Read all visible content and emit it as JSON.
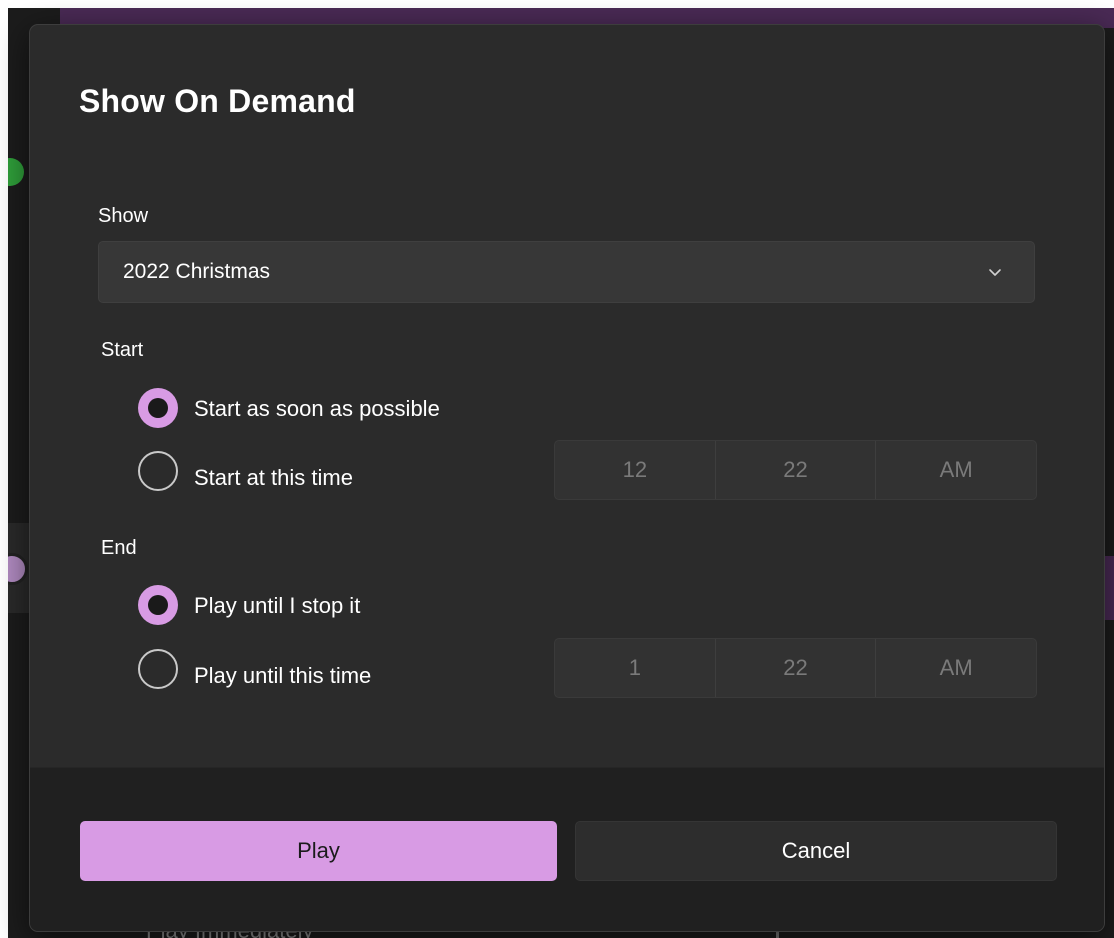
{
  "dialog": {
    "title": "Show On Demand"
  },
  "show": {
    "label": "Show",
    "selected": "2022 Christmas"
  },
  "start": {
    "label": "Start",
    "options": [
      {
        "label": "Start as soon as possible",
        "selected": true
      },
      {
        "label": "Start at this time",
        "selected": false
      }
    ],
    "time": {
      "hour": "12",
      "minute": "22",
      "period": "AM"
    }
  },
  "end": {
    "label": "End",
    "options": [
      {
        "label": "Play until I stop it",
        "selected": true
      },
      {
        "label": "Play until this time",
        "selected": false
      }
    ],
    "time": {
      "hour": "1",
      "minute": "22",
      "period": "AM"
    }
  },
  "footer": {
    "primary_label": "Play",
    "secondary_label": "Cancel"
  },
  "background": {
    "partial_text": "Play Immediately"
  },
  "colors": {
    "accent": "#d89be4",
    "dialog_bg": "#2b2b2b",
    "footer_bg": "#202020"
  },
  "icons": {
    "combo": "chevron-down-icon"
  }
}
